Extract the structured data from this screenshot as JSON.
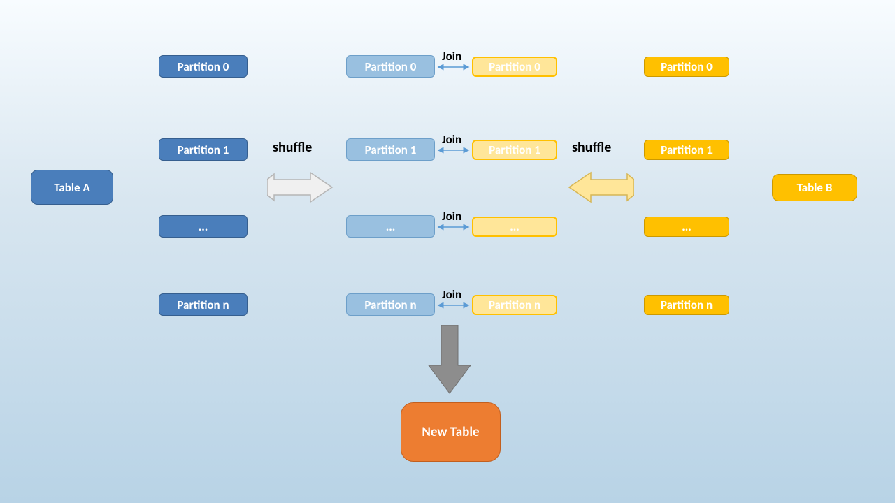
{
  "tableA": {
    "label": "Table A"
  },
  "tableB": {
    "label": "Table B"
  },
  "newTable": {
    "label": "New Table"
  },
  "partitionsA": [
    "Partition 0",
    "Partition 1",
    "...",
    "Partition n"
  ],
  "partitionsB": [
    "Partition 0",
    "Partition 1",
    "...",
    "Partition  n"
  ],
  "joinLeft": [
    "Partition 0",
    "Partition 1",
    "...",
    "Partition n"
  ],
  "joinRight": [
    "Partition 0",
    "Partition 1",
    "...",
    "Partition  n"
  ],
  "joinLabel": "Join",
  "shuffleLeft": "shuffle",
  "shuffleRight": "shuffle",
  "colors": {
    "blueSolid": "#4a7ebb",
    "blueLight": "#99c0e0",
    "yellowLight": "#ffe699",
    "yellowSolid": "#ffc000",
    "orange": "#ed7d31",
    "grayArrow": "#8d8d8d"
  }
}
